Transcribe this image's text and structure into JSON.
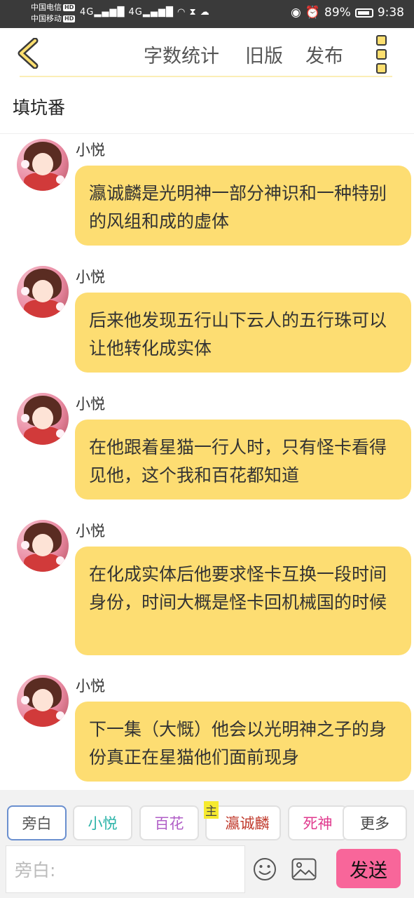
{
  "status_bar": {
    "carrier1": "中国电信",
    "carrier2": "中国移动",
    "hd": "HD",
    "signal1": "4G",
    "signal2": "4G",
    "battery": "89%",
    "time": "9:38"
  },
  "toolbar": {
    "word_count": "字数统计",
    "old_version": "旧版",
    "publish": "发布"
  },
  "page_title": "填坑番",
  "messages": [
    {
      "sender": "小悦",
      "text": "瀛诚麟是光明神一部分神识和一种特别的风组和成的虚体"
    },
    {
      "sender": "小悦",
      "text": "后来他发现五行山下云人的五行珠可以让他转化成实体"
    },
    {
      "sender": "小悦",
      "text": "在他跟着星猫一行人时，只有怪卡看得见他，这个我和百花都知道"
    },
    {
      "sender": "小悦",
      "text": "在化成实体后他要求怪卡互换一段时间身份，时间大概是怪卡回机械国的时候"
    },
    {
      "sender": "小悦",
      "text": "下一集（大慨）他会以光明神之子的身份真正在星猫他们面前现身"
    }
  ],
  "characters": {
    "narrator": {
      "label": "旁白",
      "color": "#555555"
    },
    "xiaoyue": {
      "label": "小悦",
      "color": "#2bb3a8"
    },
    "baihua": {
      "label": "百花",
      "color": "#b05ec7"
    },
    "yingchenglin": {
      "label": "瀛诚麟",
      "color": "#c0392b",
      "tag": "主"
    },
    "sishen": {
      "label": "死神",
      "color": "#e03a8e"
    },
    "more": {
      "label": "更多",
      "color": "#444444"
    }
  },
  "input": {
    "placeholder": "旁白:"
  },
  "send_label": "发送"
}
